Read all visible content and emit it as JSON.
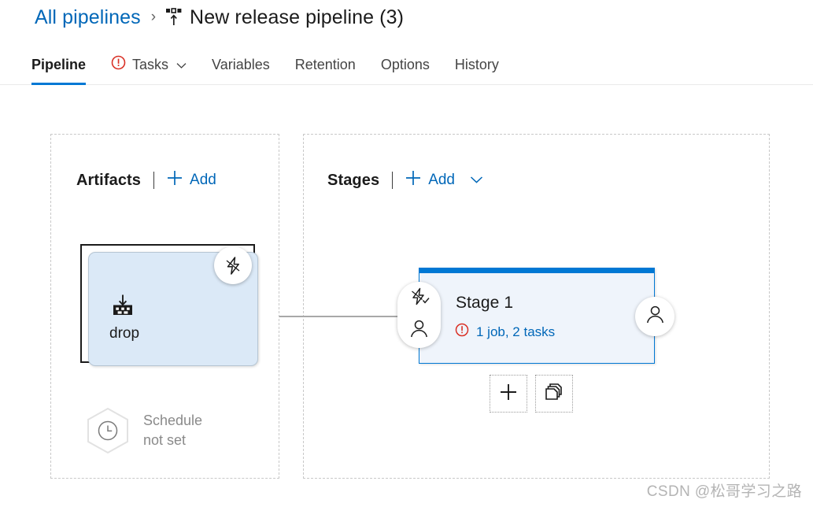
{
  "breadcrumb": {
    "parent_label": "All pipelines",
    "separator": "›",
    "icon": "release-pipeline-icon",
    "current_label": "New release pipeline (3)"
  },
  "tabs": [
    {
      "label": "Pipeline",
      "active": true,
      "icon": null,
      "chevron": false
    },
    {
      "label": "Tasks",
      "active": false,
      "icon": "error-icon",
      "chevron": true
    },
    {
      "label": "Variables",
      "active": false,
      "icon": null,
      "chevron": false
    },
    {
      "label": "Retention",
      "active": false,
      "icon": null,
      "chevron": false
    },
    {
      "label": "Options",
      "active": false,
      "icon": null,
      "chevron": false
    },
    {
      "label": "History",
      "active": false,
      "icon": null,
      "chevron": false
    }
  ],
  "artifacts": {
    "title": "Artifacts",
    "add_label": "Add",
    "node": {
      "name": "drop",
      "icon": "artifact-drop-icon",
      "badge_icon": "continuous-deployment-trigger-icon"
    },
    "schedule": {
      "icon": "clock-icon",
      "line1": "Schedule",
      "line2": "not set"
    }
  },
  "stages": {
    "title": "Stages",
    "add_label": "Add",
    "add_chevron": "chevron-down-icon",
    "stage": {
      "name": "Stage 1",
      "status_icon": "error-icon",
      "status_text": "1 job, 2 tasks",
      "left_badges": [
        "pre-deployment-conditions-icon",
        "pre-deployment-approvals-icon"
      ],
      "right_badges": [
        "post-deployment-approvals-icon"
      ]
    },
    "actions": [
      {
        "name": "add-stage-button",
        "icon": "plus-icon"
      },
      {
        "name": "clone-stage-button",
        "icon": "copy-icon"
      }
    ]
  },
  "watermark": "CSDN @松哥学习之路",
  "colors": {
    "accent": "#0078d4",
    "link": "#0067b8",
    "error": "#d93025",
    "artifact_fill": "#dbe9f7",
    "stage_fill": "#eff4fb",
    "panel_border": "#c8c8c8",
    "muted_text": "#8a8a8a"
  }
}
